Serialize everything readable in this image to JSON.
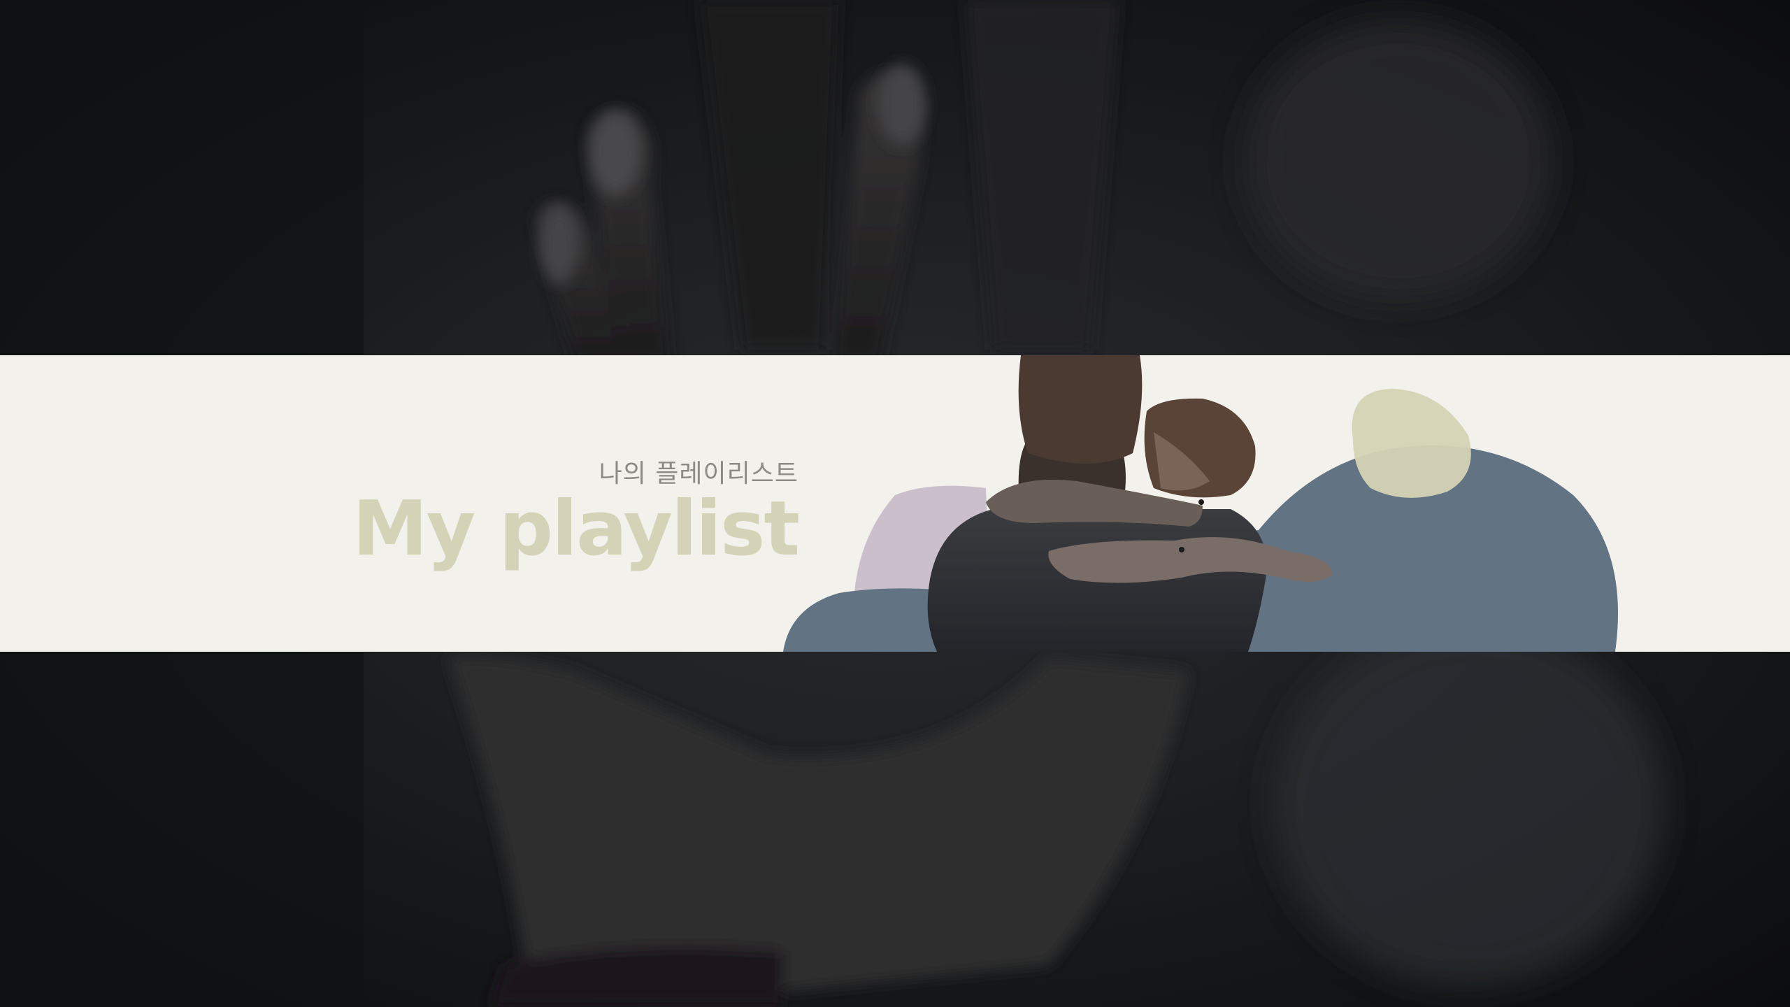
{
  "banner": {
    "subtitle": "나의 플레이리스트",
    "title": "My playlist"
  },
  "colors": {
    "band_background": "#f3f1ec",
    "title": "#d4d3b7",
    "subtitle": "#8c8a83",
    "blob_blue": "#627384",
    "blob_mauve": "#cbbfcc",
    "blob_olive": "#d5d3b4",
    "outer_background": "#121417"
  },
  "images": {
    "background": "dark photo of two hands touching",
    "center": "silhouette of two people embracing"
  }
}
